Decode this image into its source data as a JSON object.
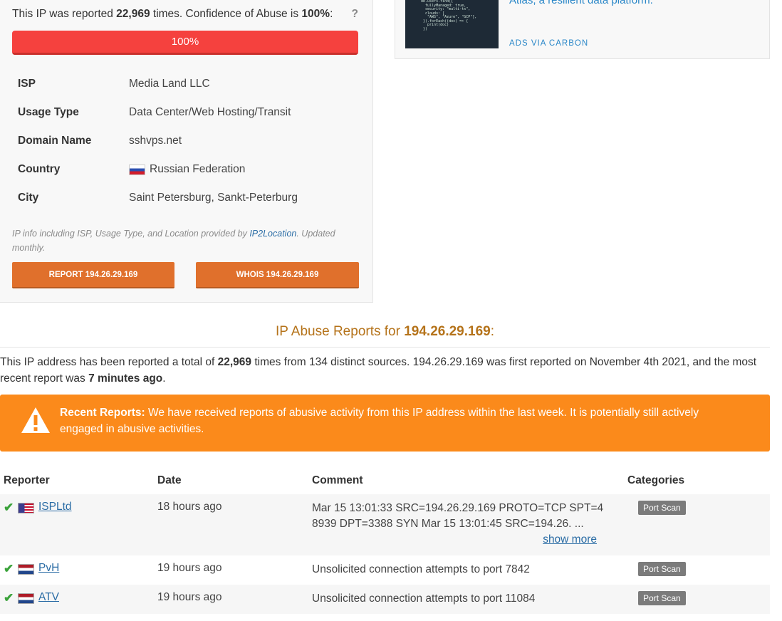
{
  "confidence": {
    "pre": "This IP was reported ",
    "count": "22,969",
    "mid": " times. Confidence of Abuse is ",
    "pct": "100%",
    "post": ":",
    "help": "?",
    "bar_label": "100%",
    "bar_fraction": 1.0,
    "bar_color": "#f5413e"
  },
  "info": [
    {
      "key": "ISP",
      "value": "Media Land LLC"
    },
    {
      "key": "Usage Type",
      "value": "Data Center/Web Hosting/Transit"
    },
    {
      "key": "Domain Name",
      "value": "sshvps.net"
    },
    {
      "key": "Country",
      "value": "Russian Federation",
      "flag": "flag-ru"
    },
    {
      "key": "City",
      "value": "Saint Petersburg, Sankt-Peterburg"
    }
  ],
  "ip_note": {
    "text": "IP info including ISP, Usage Type, and Location provided by ",
    "link": "IP2Location",
    "after": ". Updated monthly."
  },
  "buttons": {
    "report": "REPORT 194.26.29.169",
    "whois": "WHOIS 194.26.29.169",
    "color": "#e0702c"
  },
  "ad": {
    "text": "Atlas, a resilient data platform.",
    "via": "ADS VIA CARBON"
  },
  "reports": {
    "title_pre": "IP Abuse Reports for ",
    "title_ip": "194.26.29.169",
    "title_post": ":",
    "summary_1": "This IP address has been reported a total of ",
    "summary_count": "22,969",
    "summary_2": " times from 134 distinct sources. 194.26.29.169 was first reported on November 4th 2021, and the most recent report was ",
    "summary_recent": "7 minutes ago",
    "summary_3": "."
  },
  "alert": {
    "bold": "Recent Reports:",
    "text": " We have received reports of abusive activity from this IP address within the last week. It is potentially still actively engaged in abusive activities.",
    "color": "#fb8a1b",
    "icon": "warning-icon"
  },
  "table": {
    "headers": [
      "Reporter",
      "Date",
      "Comment",
      "Categories"
    ],
    "rows": [
      {
        "reporter": "ISPLtd",
        "flag": "flag-us",
        "date": "18 hours ago",
        "comment": "Mar 15 13:01:33 SRC=194.26.29.169 PROTO=TCP SPT=48939 DPT=3388 SYN Mar 15 13:01:45 SRC=194.26. ...",
        "show_more": "show more",
        "category": "Port Scan"
      },
      {
        "reporter": "PvH",
        "flag": "flag-nl",
        "date": "19 hours ago",
        "comment": "Unsolicited connection attempts to port 7842",
        "category": "Port Scan"
      },
      {
        "reporter": "ATV",
        "flag": "flag-nl",
        "date": "19 hours ago",
        "comment": "Unsolicited connection attempts to port 11084",
        "category": "Port Scan"
      }
    ]
  }
}
